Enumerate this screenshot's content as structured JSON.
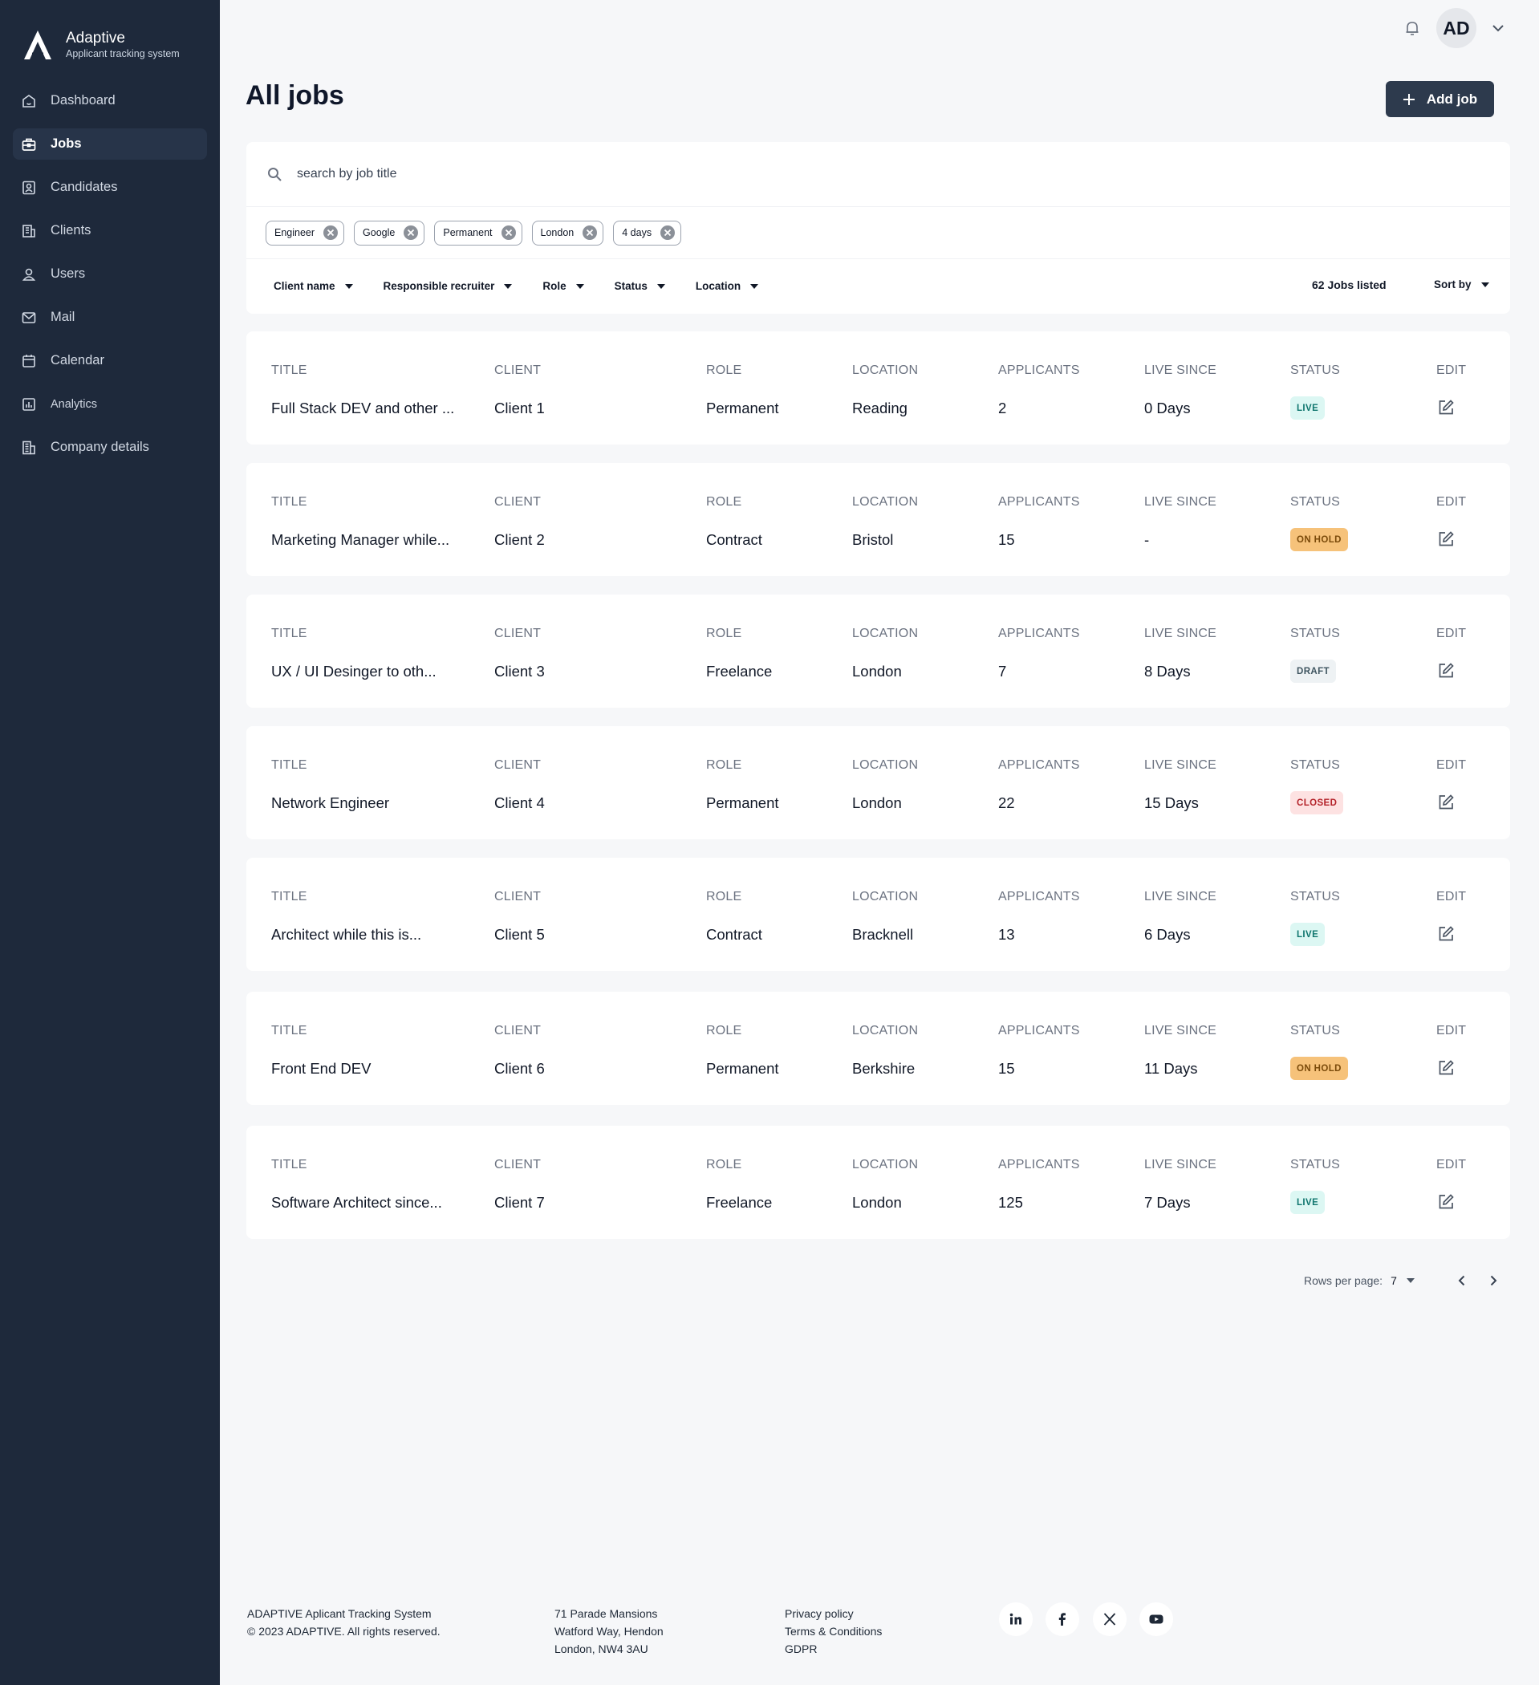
{
  "brand": {
    "name": "Adaptive",
    "subtitle": "Applicant tracking system"
  },
  "nav": [
    {
      "label": "Dashboard",
      "icon": "house-icon",
      "active": false
    },
    {
      "label": "Jobs",
      "icon": "briefcase-icon",
      "active": true
    },
    {
      "label": "Candidates",
      "icon": "candidates-icon",
      "active": false
    },
    {
      "label": "Clients",
      "icon": "clients-icon",
      "active": false
    },
    {
      "label": "Users",
      "icon": "users-icon",
      "active": false
    },
    {
      "label": "Mail",
      "icon": "mail-icon",
      "active": false
    },
    {
      "label": "Calendar",
      "icon": "calendar-icon",
      "active": false
    },
    {
      "label": "Analytics",
      "icon": "analytics-icon",
      "active": false
    },
    {
      "label": "Company details",
      "icon": "building-icon",
      "active": false
    }
  ],
  "header": {
    "avatar_initials": "AD"
  },
  "page": {
    "title": "All jobs",
    "add_job_label": "Add job"
  },
  "search": {
    "placeholder": "search by job title",
    "value": ""
  },
  "chips": [
    "Engineer",
    "Google",
    "Permanent",
    "London",
    "4 days"
  ],
  "filters": [
    "Client name",
    "Responsible recruiter",
    "Role",
    "Status",
    "Location"
  ],
  "jobs_listed": "62 Jobs listed",
  "sort_label": "Sort by",
  "columns": {
    "title": "TITLE",
    "client": "CLIENT",
    "role": "ROLE",
    "location": "LOCATION",
    "applicants": "APPLICANTS",
    "live_since": "LIVE SINCE",
    "status": "STATUS",
    "edit": "EDIT"
  },
  "jobs": [
    {
      "title": "Full Stack DEV and other ...",
      "client": "Client 1",
      "role": "Permanent",
      "location": "Reading",
      "applicants": "2",
      "live_since": "0 Days",
      "status": "LIVE",
      "status_kind": "live"
    },
    {
      "title": "Marketing Manager while...",
      "client": "Client 2",
      "role": "Contract",
      "location": "Bristol",
      "applicants": "15",
      "live_since": "-",
      "status": "ON HOLD",
      "status_kind": "hold"
    },
    {
      "title": "UX / UI Desinger to oth...",
      "client": "Client 3",
      "role": "Freelance",
      "location": "London",
      "applicants": "7",
      "live_since": "8 Days",
      "status": "DRAFT",
      "status_kind": "draft"
    },
    {
      "title": "Network Engineer",
      "client": "Client 4",
      "role": "Permanent",
      "location": "London",
      "applicants": "22",
      "live_since": "15 Days",
      "status": "CLOSED",
      "status_kind": "closed"
    },
    {
      "title": "Architect while this is...",
      "client": "Client 5",
      "role": "Contract",
      "location": "Bracknell",
      "applicants": "13",
      "live_since": "6 Days",
      "status": "LIVE",
      "status_kind": "live"
    },
    {
      "title": "Front End DEV",
      "client": "Client 6",
      "role": "Permanent",
      "location": "Berkshire",
      "applicants": "15",
      "live_since": "11 Days",
      "status": "ON HOLD",
      "status_kind": "hold"
    },
    {
      "title": "Software Architect since...",
      "client": "Client 7",
      "role": "Freelance",
      "location": "London",
      "applicants": "125",
      "live_since": "7 Days",
      "status": "LIVE",
      "status_kind": "live"
    }
  ],
  "pagination": {
    "rows_label": "Rows per page:",
    "rows_value": "7"
  },
  "footer": {
    "company": [
      "ADAPTIVE Aplicant Tracking System",
      "© 2023 ADAPTIVE. All rights reserved."
    ],
    "address": [
      "71 Parade Mansions",
      "Watford Way, Hendon",
      "London, NW4 3AU"
    ],
    "links": [
      "Privacy policy",
      "Terms & Conditions",
      "GDPR"
    ],
    "social": [
      "linkedin-icon",
      "facebook-icon",
      "x-icon",
      "youtube-icon"
    ]
  },
  "colors": {
    "sidebar": "#1e293b",
    "button": "#2d3a4d",
    "live": "#dcf7f3",
    "hold": "#f6c27a",
    "draft": "#eef2f4",
    "closed": "#fde2e2"
  }
}
